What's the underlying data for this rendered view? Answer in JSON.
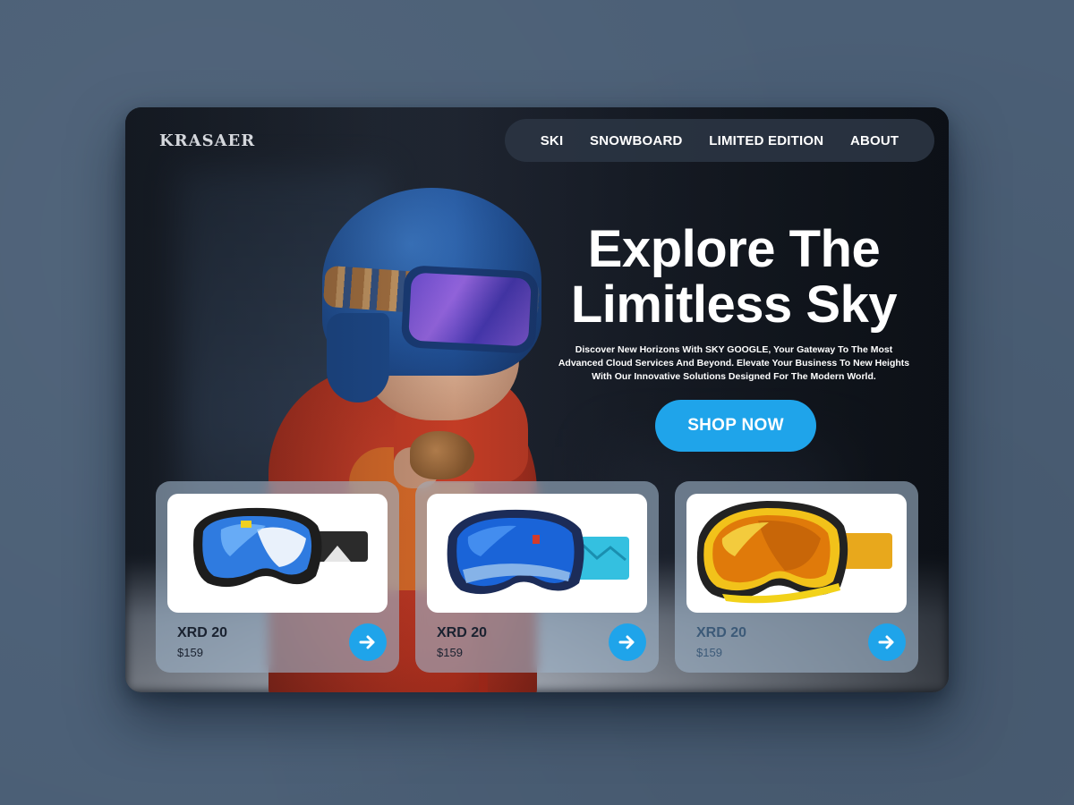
{
  "brand": {
    "logo": "KRASAER"
  },
  "nav": {
    "items": [
      {
        "label": "SKI"
      },
      {
        "label": "SNOWBOARD"
      },
      {
        "label": "LIMITED EDITION"
      },
      {
        "label": "ABOUT"
      }
    ]
  },
  "hero": {
    "title_line1": "Explore The",
    "title_line2": "Limitless Sky",
    "subtitle_line1": "Discover New Horizons With SKY GOOGLE, Your Gateway To The Most",
    "subtitle_line2": "Advanced Cloud Services And Beyond. Elevate Your Business To New Heights",
    "subtitle_line3": "With Our Innovative Solutions Designed For The Modern World.",
    "cta_label": "SHOP NOW"
  },
  "products": [
    {
      "name": "XRD 20",
      "price": "$159",
      "lens": "blue-mirror"
    },
    {
      "name": "XRD 20",
      "price": "$159",
      "lens": "blue-cyan-strap"
    },
    {
      "name": "XRD 20",
      "price": "$159",
      "lens": "gold-yellow"
    }
  ],
  "icons": {
    "card_action": "arrow-right-icon"
  },
  "colors": {
    "accent": "#1fa4ea",
    "background": "#4b5f76",
    "nav_bg": "#2a3442",
    "card_bg": "#9cb2c6"
  }
}
